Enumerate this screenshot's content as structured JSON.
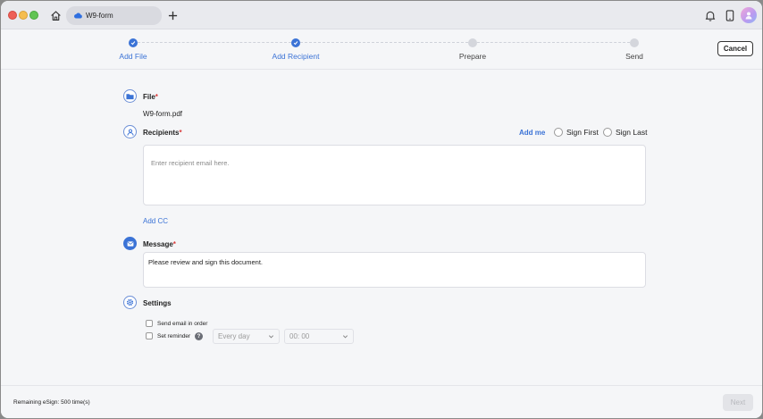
{
  "tab": {
    "title": "W9-form"
  },
  "steps": [
    {
      "label": "Add File",
      "state": "done"
    },
    {
      "label": "Add Recipient",
      "state": "done"
    },
    {
      "label": "Prepare",
      "state": "todo"
    },
    {
      "label": "Send",
      "state": "todo"
    }
  ],
  "header": {
    "cancel_label": "Cancel"
  },
  "file": {
    "title": "File",
    "required": "*",
    "filename": "W9-form.pdf"
  },
  "recipients": {
    "title": "Recipients",
    "required": "*",
    "add_me": "Add me",
    "sign_first": "Sign First",
    "sign_last": "Sign Last",
    "placeholder": "Enter recipient email here.",
    "add_cc": "Add CC"
  },
  "message": {
    "title": "Message",
    "required": "*",
    "value": "Please review and sign this document."
  },
  "settings": {
    "title": "Settings",
    "send_in_order": "Send email in order",
    "set_reminder": "Set reminder",
    "help": "?",
    "frequency": "Every day",
    "time": "00: 00"
  },
  "footer": {
    "remaining": "Remaining eSign: 500 time(s)",
    "next_label": "Next"
  },
  "colors": {
    "accent": "#3b73d6",
    "required": "#d93b3b"
  }
}
